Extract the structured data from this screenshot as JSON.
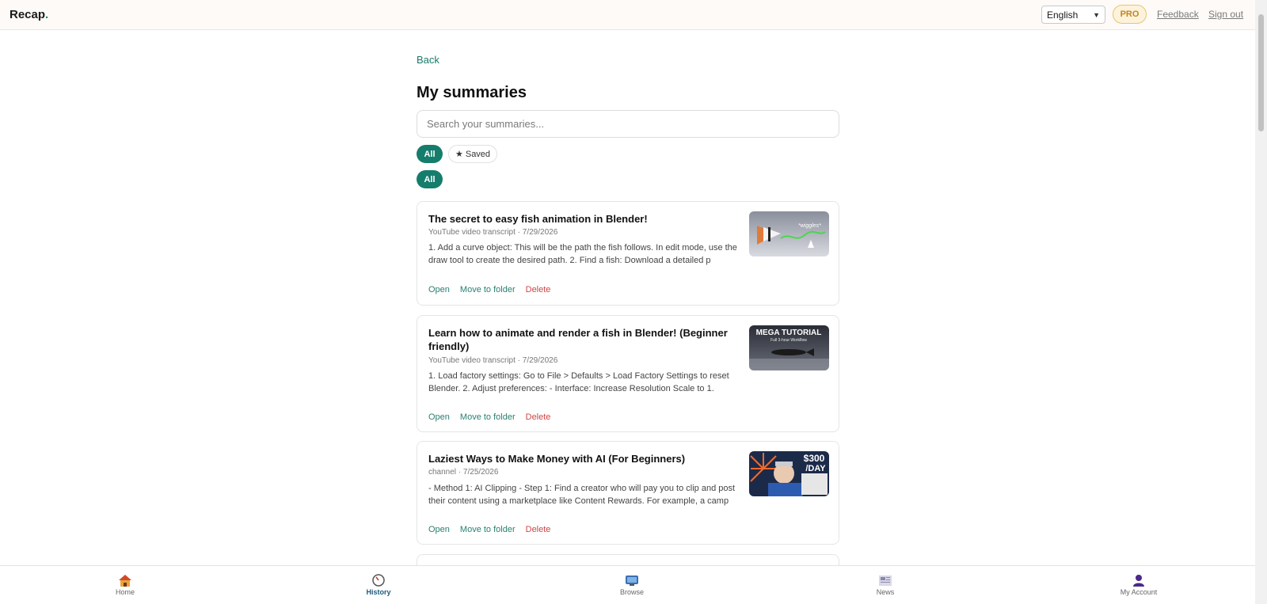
{
  "header": {
    "brand": "Recap",
    "brand_dot": ".",
    "language": "English",
    "pro_label": "PRO",
    "feedback_label": "Feedback",
    "signout_label": "Sign out"
  },
  "main": {
    "back_label": "Back",
    "title": "My summaries",
    "search_placeholder": "Search your summaries...",
    "filters": [
      {
        "label": "All",
        "active": true
      },
      {
        "label": "★ Saved",
        "active": false
      }
    ],
    "folder_filters": [
      {
        "label": "All",
        "active": true
      }
    ],
    "summaries": [
      {
        "title": "The secret to easy fish animation in Blender!",
        "meta": "YouTube video transcript · 7/29/2026",
        "excerpt": "1. Add a curve object: This will be the path the fish follows. In edit mode, use the draw tool to create the desired path. 2. Find a fish: Download a detailed p",
        "thumb_text": "*wiggles*",
        "open_label": "Open",
        "move_label": "Move to folder",
        "delete_label": "Delete"
      },
      {
        "title": "Learn how to animate and render a fish in Blender! (Beginner friendly)",
        "meta": "YouTube video transcript · 7/29/2026",
        "excerpt": "1. Load factory settings: Go to File > Defaults > Load Factory Settings to reset Blender. 2. Adjust preferences: - Interface: Increase Resolution Scale to 1.",
        "thumb_text": "MEGA TUTORIAL",
        "thumb_subtext": "Full 3-hour Workflow",
        "open_label": "Open",
        "move_label": "Move to folder",
        "delete_label": "Delete"
      },
      {
        "title": "Laziest Ways to Make Money with AI (For Beginners)",
        "meta": "channel · 7/25/2026",
        "excerpt": "- Method 1: AI Clipping - Step 1: Find a creator who will pay you to clip and post their content using a marketplace like Content Rewards. For example, a camp",
        "thumb_text": "$300",
        "thumb_subtext": "/DAY",
        "open_label": "Open",
        "move_label": "Move to folder",
        "delete_label": "Delete"
      }
    ]
  },
  "bottom_nav": [
    {
      "label": "Home",
      "icon": "house-icon",
      "active": false
    },
    {
      "label": "History",
      "icon": "clock-icon",
      "active": true
    },
    {
      "label": "Browse",
      "icon": "tv-icon",
      "active": false
    },
    {
      "label": "News",
      "icon": "newspaper-icon",
      "active": false
    },
    {
      "label": "My Account",
      "icon": "user-icon",
      "active": false
    }
  ],
  "colors": {
    "accent": "#157d6c",
    "pro": "#c8831a",
    "delete": "#d04545"
  }
}
